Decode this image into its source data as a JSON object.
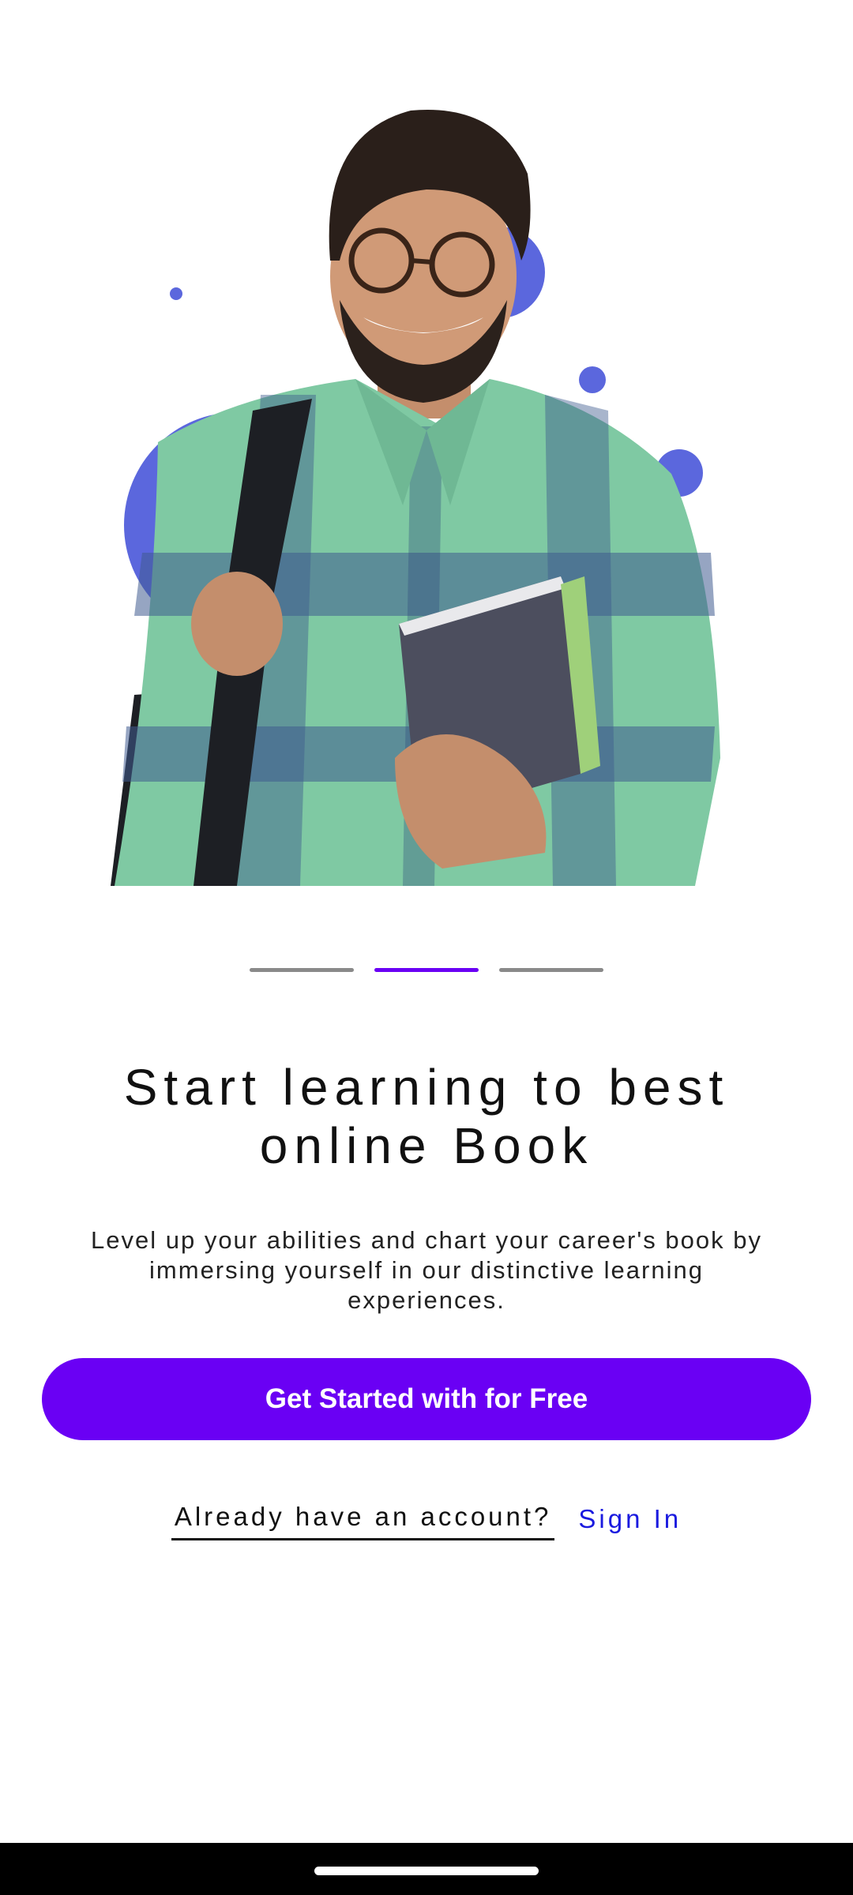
{
  "onboarding": {
    "title": "Start learning to best online Book",
    "description": "Level up your abilities and chart your career's book by immersing yourself in our distinctive learning experiences.",
    "cta_label": "Get Started with for Free",
    "account_prompt": "Already have an account?",
    "signin_label": "Sign In",
    "pager": {
      "total": 3,
      "active_index": 1
    }
  },
  "colors": {
    "accent": "#6a00f4",
    "link": "#1a1adf",
    "circle_accent": "#5b67dd",
    "pager_inactive": "#8a8a8a",
    "background": "#ffffff"
  },
  "icons": {
    "hero": "student-with-books-illustration"
  }
}
